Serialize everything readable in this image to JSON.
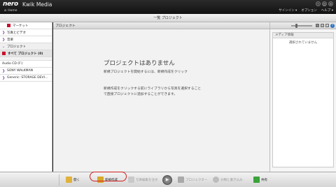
{
  "app": {
    "brand": "nero",
    "name": "Kwik Media",
    "home_label": "Home"
  },
  "top_menu": {
    "signin": "サインイン ▾",
    "options": "オプション",
    "help": "ヘルプ ▾"
  },
  "view_header": "一覧 プロジェクト",
  "sidebar": {
    "items": [
      {
        "label": "マーケット",
        "icon": "market-icon",
        "icon_color": "#c8102e"
      },
      {
        "label": "写真とビデオ",
        "arrow": "❯"
      },
      {
        "label": "音楽",
        "arrow": "❯"
      },
      {
        "label": "プロジェクト",
        "arrow": "⌄"
      },
      {
        "label": "すべて プロジェクト (0)",
        "icon": "project-icon",
        "icon_color": "#c8102e"
      },
      {
        "label": "Audio CD (F:)"
      },
      {
        "label": "SONY WALKMAN",
        "arrow": "❯"
      },
      {
        "label": "Generic: STORAGE DEVI...",
        "arrow": "❯"
      }
    ]
  },
  "main": {
    "header": "プロジェクト",
    "empty_title": "プロジェクトはありません",
    "empty_sub": "新規プロジェクトを開始するには、新規作成をクリック",
    "hint_line1": "新規作成をクリックする前にライブラリから写真を選択すること",
    "hint_line2": "で直接プロジェクトに追加することができます。"
  },
  "right_panel": {
    "help_glyph": "?",
    "header": "メディア情報",
    "empty": "選択されていません"
  },
  "bottom_toolbar": {
    "open": "開く",
    "new": "新規作成",
    "edit_with_photo": "写真編集を注文",
    "projector": "プロジェクター",
    "burn": "分類と書き込み",
    "share": "共有",
    "play_glyph": "▶"
  },
  "colors": {
    "accent_red": "#c8102e",
    "purple_arrow": "#7a3aa8",
    "highlight": "#d21d1d"
  }
}
